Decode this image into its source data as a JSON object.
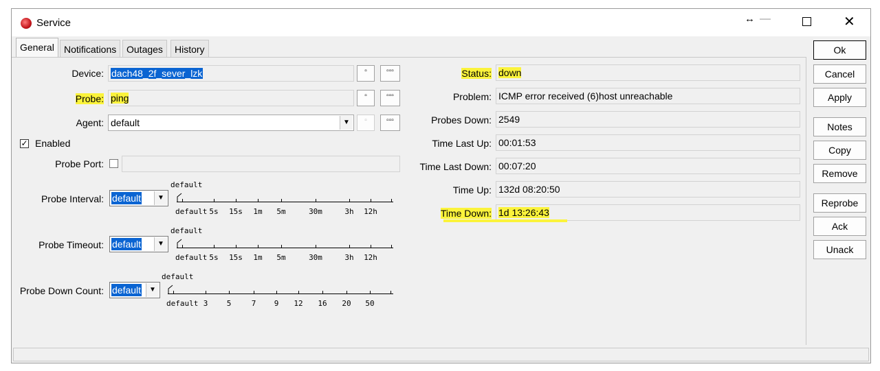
{
  "window": {
    "title": "Service"
  },
  "tabs": [
    "General",
    "Notifications",
    "Outages",
    "History"
  ],
  "general": {
    "device": {
      "label": "Device:",
      "value": "dach48_2f_sever_lzk"
    },
    "probe": {
      "label": "Probe:",
      "value": "ping"
    },
    "agent": {
      "label": "Agent:",
      "value": "default"
    },
    "enabled": {
      "label": "Enabled",
      "checked": true
    },
    "probe_port": {
      "label": "Probe Port:",
      "value": ""
    },
    "probe_interval": {
      "label": "Probe Interval:",
      "value": "default",
      "current": "default",
      "ticks": [
        "default",
        "5s",
        "15s",
        "1m",
        "5m",
        "30m",
        "3h",
        "12h"
      ]
    },
    "probe_timeout": {
      "label": "Probe Timeout:",
      "value": "default",
      "current": "default",
      "ticks": [
        "default",
        "5s",
        "15s",
        "1m",
        "5m",
        "30m",
        "3h",
        "12h"
      ]
    },
    "probe_down_count": {
      "label": "Probe Down Count:",
      "value": "default",
      "current": "default",
      "ticks": [
        "default",
        "3",
        "5",
        "7",
        "9",
        "12",
        "16",
        "20",
        "50"
      ]
    },
    "button_small": "▫",
    "button_more": "▫▫▫"
  },
  "status": {
    "status": {
      "label": "Status:",
      "value": "down"
    },
    "problem": {
      "label": "Problem:",
      "value": "ICMP error received (6)host unreachable"
    },
    "probes_down": {
      "label": "Probes Down:",
      "value": "2549"
    },
    "time_last_up": {
      "label": "Time Last Up:",
      "value": "00:01:53"
    },
    "time_last_down": {
      "label": "Time Last Down:",
      "value": "00:07:20"
    },
    "time_up": {
      "label": "Time Up:",
      "value": "132d 08:20:50"
    },
    "time_down": {
      "label": "Time Down:",
      "value": "1d 13:26:43"
    }
  },
  "buttons": [
    "Ok",
    "Cancel",
    "Apply",
    "Notes",
    "Copy",
    "Remove",
    "Reprobe",
    "Ack",
    "Unack"
  ],
  "colors": {
    "highlight": "#fbf33b",
    "selection": "#0a64d2"
  }
}
